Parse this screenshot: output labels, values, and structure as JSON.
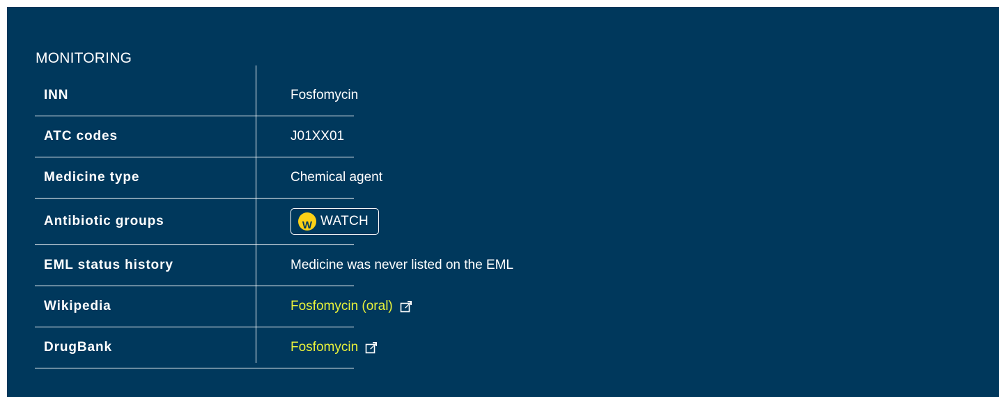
{
  "section": {
    "title": "MONITORING"
  },
  "rows": [
    {
      "label": "INN",
      "value": "Fosfomycin"
    },
    {
      "label": "ATC codes",
      "value": "J01XX01"
    },
    {
      "label": "Medicine type",
      "value": "Chemical agent"
    },
    {
      "label": "Antibiotic groups",
      "badge_letter": "W",
      "badge_text": "WATCH"
    },
    {
      "label": "EML status history",
      "value": "Medicine was never listed on the EML"
    },
    {
      "label": "Wikipedia",
      "link_text": "Fosfomycin (oral)",
      "icon": "external-link-icon"
    },
    {
      "label": "DrugBank",
      "link_text": "Fosfomycin",
      "icon": "external-link-icon"
    }
  ],
  "colors": {
    "panel_background": "#00385c",
    "link": "#e8f23a",
    "watch_badge": "#fcd116",
    "text": "#ffffff"
  }
}
